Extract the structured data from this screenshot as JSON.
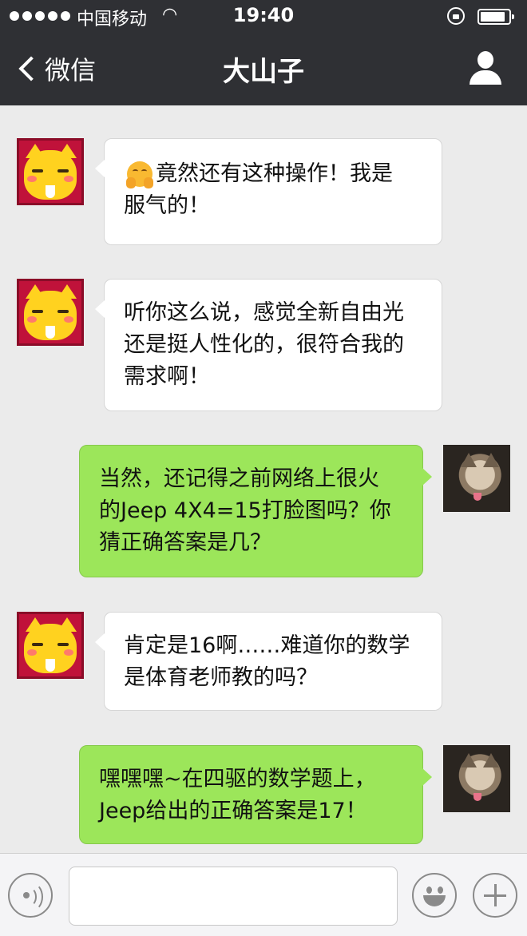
{
  "status_bar": {
    "carrier": "中国移动",
    "time": "19:40"
  },
  "nav": {
    "back_label": "微信",
    "title": "大山子"
  },
  "messages": [
    {
      "side": "left",
      "avatar": "cartoon-cat-avatar",
      "has_emoji": true,
      "emoji": "hugging-face-emoji",
      "lines": [
        "竟然还有这种操作！我是",
        "服气的！"
      ]
    },
    {
      "side": "left",
      "avatar": "cartoon-cat-avatar",
      "lines": [
        "听你这么说，感觉全新自由光",
        "还是挺人性化的，很符合我的",
        "需求啊！"
      ]
    },
    {
      "side": "right",
      "avatar": "cat-photo-avatar",
      "lines": [
        "当然，还记得之前网络上很火",
        "的Jeep 4X4=15打脸图吗？你",
        "猜正确答案是几？"
      ]
    },
    {
      "side": "left",
      "avatar": "cartoon-cat-avatar",
      "lines": [
        "肯定是16啊……难道你的数学",
        "是体育老师教的吗？"
      ]
    },
    {
      "side": "right",
      "avatar": "cat-photo-avatar",
      "lines": [
        "嘿嘿嘿~在四驱的数学题上，",
        "Jeep给出的正确答案是17！"
      ]
    }
  ],
  "input_bar": {
    "text_value": "",
    "icons": [
      "voice-icon",
      "emoji-icon",
      "plus-icon"
    ]
  },
  "colors": {
    "nav_bg": "#2f3034",
    "chat_bg": "#ebebeb",
    "sent_bubble": "#9ce65a",
    "received_bubble": "#ffffff"
  }
}
